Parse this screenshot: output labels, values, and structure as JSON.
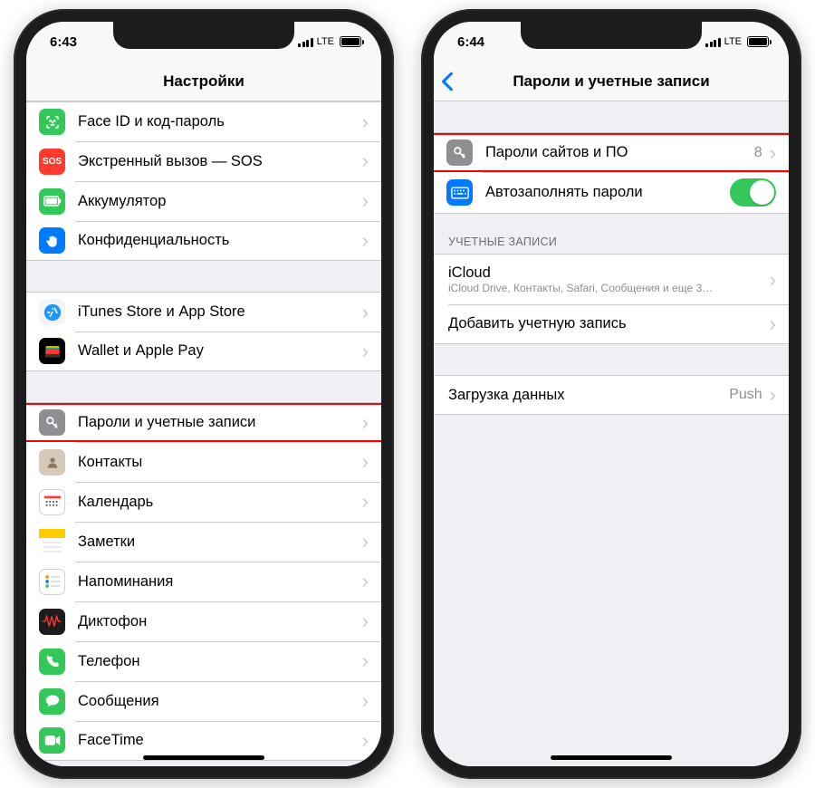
{
  "left": {
    "status": {
      "time": "6:43",
      "carrier": "LTE"
    },
    "navTitle": "Настройки",
    "rows": {
      "faceid": "Face ID и код-пароль",
      "sos": "Экстренный вызов — SOS",
      "sosIcon": "SOS",
      "battery": "Аккумулятор",
      "privacy": "Конфиденциальность",
      "appstore": "iTunes Store и App Store",
      "wallet": "Wallet и Apple Pay",
      "passwords": "Пароли и учетные записи",
      "contacts": "Контакты",
      "calendar": "Календарь",
      "notes": "Заметки",
      "reminders": "Напоминания",
      "voice": "Диктофон",
      "phone": "Телефон",
      "messages": "Сообщения",
      "facetime": "FaceTime"
    }
  },
  "right": {
    "status": {
      "time": "6:44",
      "carrier": "LTE"
    },
    "navTitle": "Пароли и учетные записи",
    "rows": {
      "sitePasswords": "Пароли сайтов и ПО",
      "sitePasswordsCount": "8",
      "autofill": "Автозаполнять пароли",
      "accountsHeader": "УЧЕТНЫЕ ЗАПИСИ",
      "icloud": "iCloud",
      "icloudSub": "iCloud Drive, Контакты, Safari, Сообщения и еще 3…",
      "addAccount": "Добавить учетную запись",
      "fetch": "Загрузка данных",
      "fetchValue": "Push"
    }
  }
}
